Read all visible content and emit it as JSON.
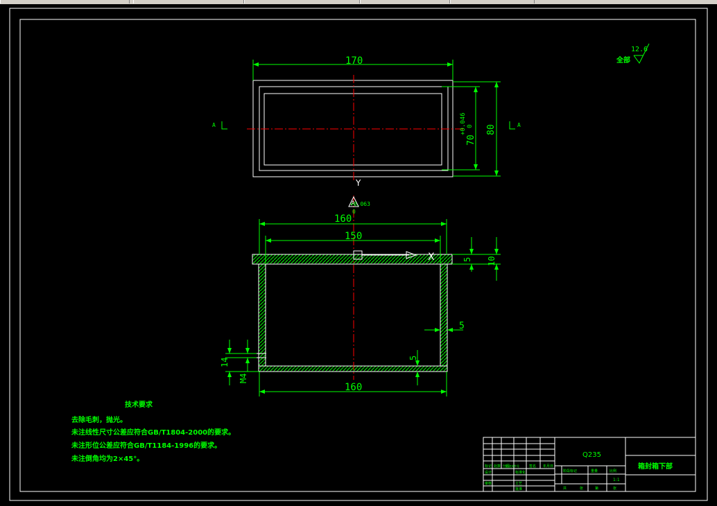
{
  "drawing": {
    "surface_finish": {
      "label": "全部",
      "value": "12.6"
    },
    "top_view": {
      "width_dim": "170",
      "height_dim": "80",
      "inner_dim_main": "70",
      "inner_tol_upper": "+0.046",
      "inner_tol_lower": "0",
      "section_label_y": "Y",
      "section_mark_left": "A",
      "section_mark_right": "A"
    },
    "front_view": {
      "top_dim_main": "160",
      "top_tol_upper": "+0.063",
      "top_tol_lower": "0",
      "inner_width_dim": "150",
      "flange_dim_5": "5",
      "flange_dim_10": "10",
      "wall_dim": "5",
      "bottom_dim": "5",
      "bottom_width_dim": "160",
      "hole_dim_14": "14",
      "thread_dim": "M4",
      "marker_x": "X",
      "marker_y": "Y"
    },
    "notes": {
      "title": "技术要求",
      "items": [
        "去除毛刺，抛光。",
        "未注线性尺寸公差应符合GB/T1804-2000的要求。",
        "未注形位公差应符合GB/T1184-1996的要求。",
        "未注倒角均为2×45°。"
      ]
    },
    "title_block": {
      "material": "Q235",
      "part_name": "箱封箱下部",
      "scale": "1:1",
      "sheet_labels": [
        "共",
        "张",
        "第",
        "张"
      ],
      "cells": [
        "标记",
        "处数",
        "分区",
        "更改文件号",
        "签名",
        "年月日",
        "设计",
        "标准化",
        "审核",
        "工艺",
        "批准",
        "阶段标记",
        "重量",
        "比例"
      ]
    }
  }
}
